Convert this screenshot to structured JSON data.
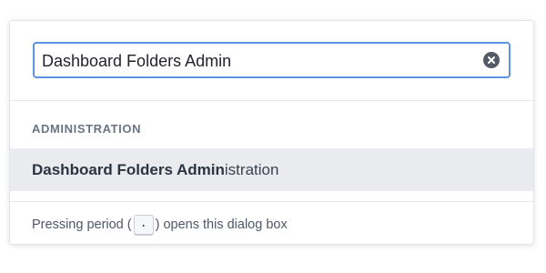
{
  "search": {
    "value": "Dashboard Folders Admin",
    "clear_icon": "clear-circle-icon"
  },
  "section": {
    "label": "ADMINISTRATION"
  },
  "results": [
    {
      "match": "Dashboard Folders Admin",
      "rest": "istration"
    }
  ],
  "footer": {
    "before": "Pressing period (",
    "key": ".",
    "after": ") opens this dialog box"
  },
  "colors": {
    "focus_border": "#5b95e0",
    "selected_row": "#e9ebef",
    "section_label": "#6b7484"
  }
}
